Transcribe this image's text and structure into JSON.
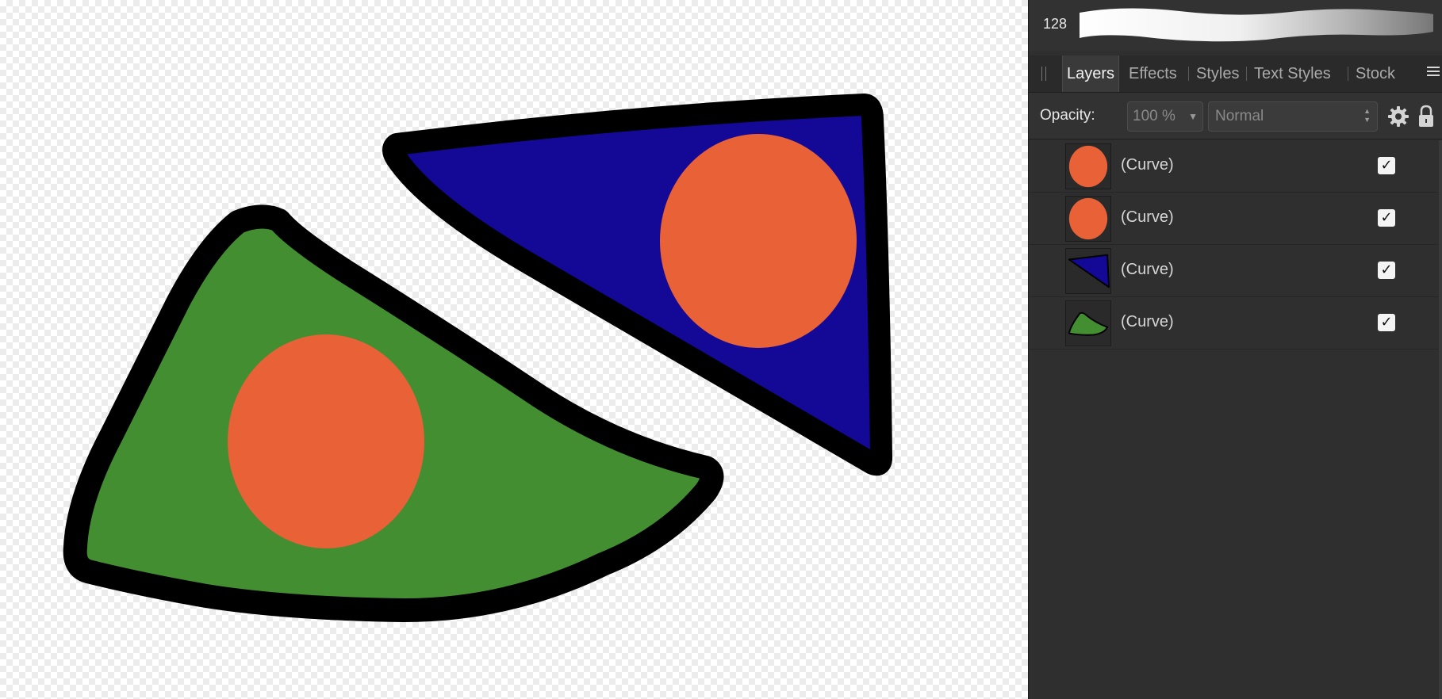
{
  "brush": {
    "size": "128"
  },
  "tabs": [
    {
      "label": "Layers",
      "active": true
    },
    {
      "label": "Effects",
      "active": false
    },
    {
      "label": "Styles",
      "active": false
    },
    {
      "label": "Text Styles",
      "active": false
    },
    {
      "label": "Stock",
      "active": false
    }
  ],
  "layer_controls": {
    "opacity_label": "Opacity:",
    "opacity_value": "100 %",
    "blend_mode": "Normal"
  },
  "layers": [
    {
      "name": "(Curve)",
      "visible": true,
      "thumbnail": "orange-circle"
    },
    {
      "name": "(Curve)",
      "visible": true,
      "thumbnail": "orange-circle"
    },
    {
      "name": "(Curve)",
      "visible": true,
      "thumbnail": "blue-triangle"
    },
    {
      "name": "(Curve)",
      "visible": true,
      "thumbnail": "green-wedge"
    }
  ],
  "colors": {
    "green_fill": "#438e31",
    "blue_fill": "#140896",
    "orange_fill": "#e96137",
    "outline": "#000000",
    "panel_bg": "#2f2f2f"
  }
}
